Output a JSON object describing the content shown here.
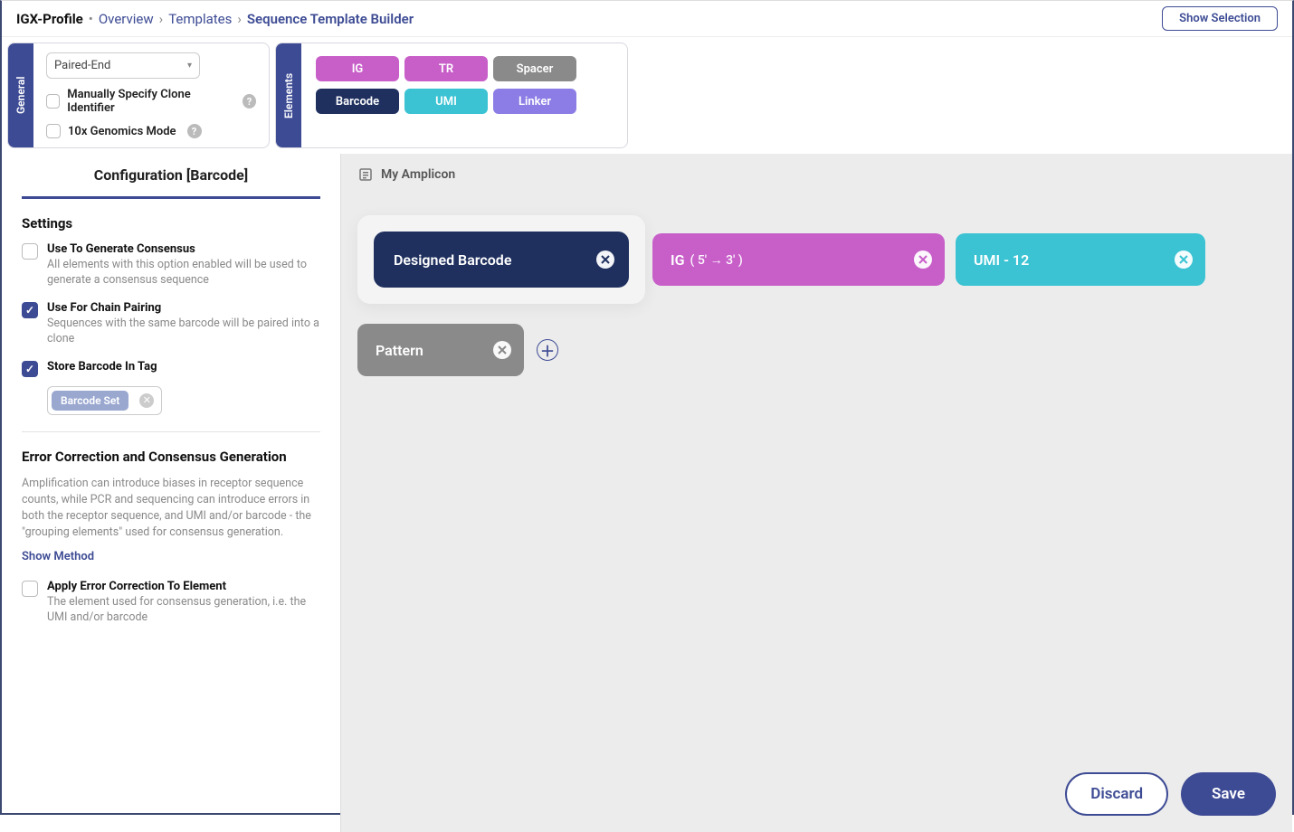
{
  "breadcrumb": {
    "root": "IGX-Profile",
    "a": "Overview",
    "b": "Templates",
    "c": "Sequence Template Builder"
  },
  "topbar": {
    "show_selection": "Show Selection"
  },
  "general": {
    "tab": "General",
    "select": "Paired-End",
    "opt1": "Manually Specify Clone Identifier",
    "opt2": "10x Genomics Mode"
  },
  "elements_panel": {
    "tab": "Elements",
    "ig": "IG",
    "tr": "TR",
    "spacer": "Spacer",
    "barcode": "Barcode",
    "umi": "UMI",
    "linker": "Linker"
  },
  "config": {
    "title": "Configuration [Barcode]",
    "settings_heading": "Settings",
    "s1": {
      "label": "Use To Generate Consensus",
      "desc": "All elements with this option enabled will be used to generate a consensus sequence"
    },
    "s2": {
      "label": "Use For Chain Pairing",
      "desc": "Sequences with the same barcode will be paired into a clone"
    },
    "s3": {
      "label": "Store Barcode In Tag"
    },
    "tag": "Barcode Set",
    "err_heading": "Error Correction and Consensus Generation",
    "err_desc": "Amplification can introduce biases in receptor sequence counts, while PCR and sequencing can introduce errors in both the receptor sequence, and UMI and/or barcode - the \"grouping elements\" used for consensus generation.",
    "show_method": "Show Method",
    "s4": {
      "label": "Apply Error Correction To Element",
      "desc": "The element used for consensus generation, i.e. the UMI and/or barcode"
    }
  },
  "canvas": {
    "amplicon": "My Amplicon",
    "b1": "Designed Barcode",
    "b2": "IG",
    "b2_dir": "( 5' → 3' )",
    "b3": "UMI - 12",
    "b4": "Pattern"
  },
  "footer": {
    "discard": "Discard",
    "save": "Save"
  }
}
